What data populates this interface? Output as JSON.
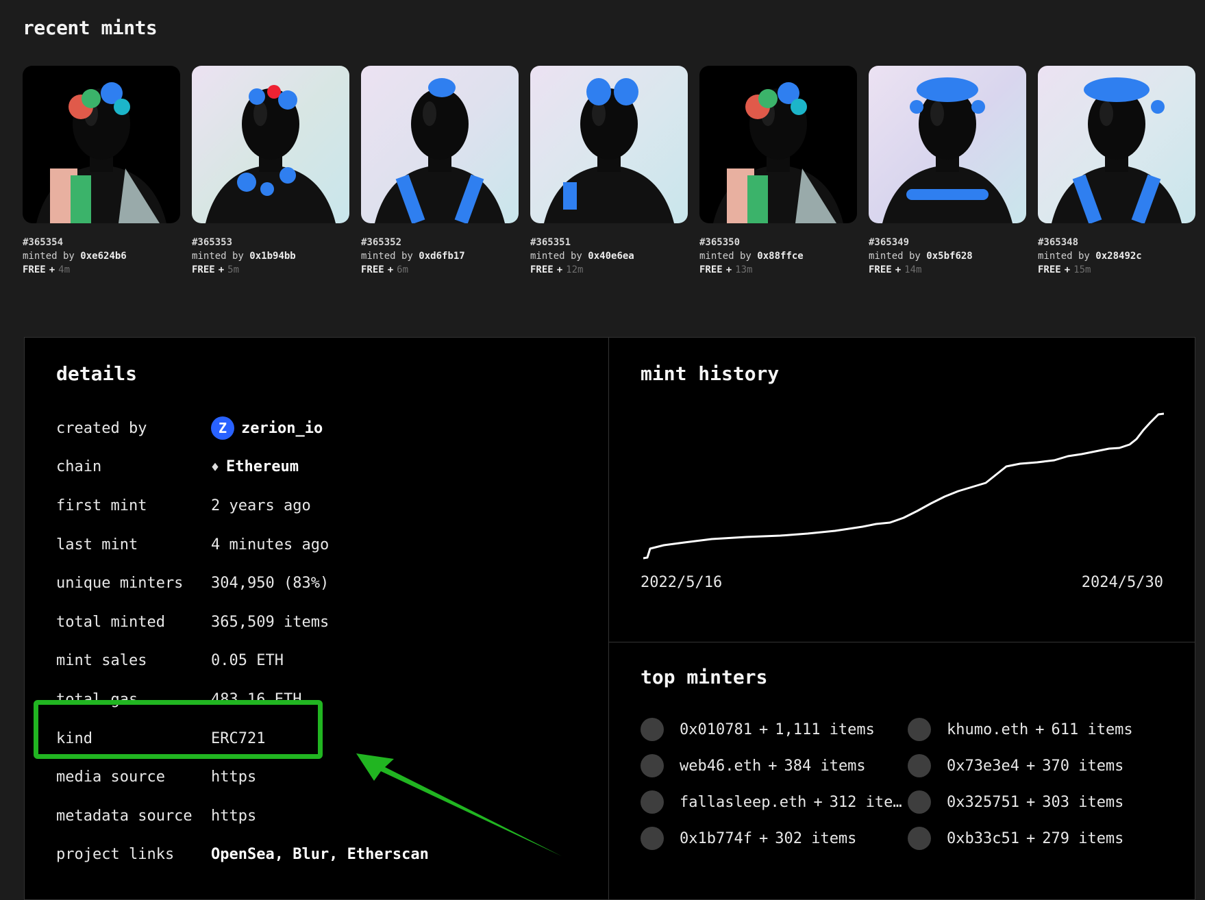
{
  "recent_title": "recent mints",
  "mints": [
    {
      "id": "#365354",
      "by_prefix": "minted by",
      "by": "0xe624b6",
      "price": "FREE",
      "sep": "+",
      "ago": "4m",
      "bg": "#000000",
      "accent": "#3aa0e0",
      "style": "colorful"
    },
    {
      "id": "#365353",
      "by_prefix": "minted by",
      "by": "0x1b94bb",
      "price": "FREE",
      "sep": "+",
      "ago": "5m",
      "bg": "#d8e6e4",
      "accent": "#2f7ff0",
      "style": "blobs"
    },
    {
      "id": "#365352",
      "by_prefix": "minted by",
      "by": "0xd6fb17",
      "price": "FREE",
      "sep": "+",
      "ago": "6m",
      "bg": "#dfe1ee",
      "accent": "#2f7ff0",
      "style": "straps"
    },
    {
      "id": "#365351",
      "by_prefix": "minted by",
      "by": "0x40e6ea",
      "price": "FREE",
      "sep": "+",
      "ago": "12m",
      "bg": "#dbe7ee",
      "accent": "#2f7ff0",
      "style": "bow"
    },
    {
      "id": "#365350",
      "by_prefix": "minted by",
      "by": "0x88ffce",
      "price": "FREE",
      "sep": "+",
      "ago": "13m",
      "bg": "#000000",
      "accent": "#3aa0e0",
      "style": "colorful"
    },
    {
      "id": "#365349",
      "by_prefix": "minted by",
      "by": "0x5bf628",
      "price": "FREE",
      "sep": "+",
      "ago": "14m",
      "bg": "#d9d6ee",
      "accent": "#2f7ff0",
      "style": "curls"
    },
    {
      "id": "#365348",
      "by_prefix": "minted by",
      "by": "0x28492c",
      "price": "FREE",
      "sep": "+",
      "ago": "15m",
      "bg": "#dde8ee",
      "accent": "#2f7ff0",
      "style": "curls-straps"
    }
  ],
  "details": {
    "title": "details",
    "created_by_label": "created by",
    "created_by_icon": "Z",
    "created_by": "zerion_io",
    "chain_label": "chain",
    "chain_icon": "♦",
    "chain": "Ethereum",
    "first_mint_label": "first mint",
    "first_mint": "2 years ago",
    "last_mint_label": "last mint",
    "last_mint": "4 minutes ago",
    "unique_minters_label": "unique minters",
    "unique_minters": "304,950 (83%)",
    "total_minted_label": "total minted",
    "total_minted": "365,509 items",
    "mint_sales_label": "mint sales",
    "mint_sales": "0.05 ETH",
    "total_gas_label": "total gas",
    "total_gas": "483.16 ETH",
    "kind_label": "kind",
    "kind": "ERC721",
    "media_source_label": "media source",
    "media_source": "https",
    "metadata_source_label": "metadata source",
    "metadata_source": "https",
    "project_links_label": "project links",
    "project_links": "OpenSea, Blur, Etherscan"
  },
  "history": {
    "title": "mint history",
    "start_date": "2022/5/16",
    "end_date": "2024/5/30"
  },
  "minters": {
    "title": "top minters",
    "sep": "+",
    "items": [
      {
        "name": "0x010781",
        "count": "1,111 items"
      },
      {
        "name": "khumo.eth",
        "count": "611 items"
      },
      {
        "name": "web46.eth",
        "count": "384 items"
      },
      {
        "name": "0x73e3e4",
        "count": "370 items"
      },
      {
        "name": "fallasleep.eth",
        "count": "312 ite…"
      },
      {
        "name": "0x325751",
        "count": "303 items"
      },
      {
        "name": "0x1b774f",
        "count": "302 items"
      },
      {
        "name": "0xb33c51",
        "count": "279 items"
      }
    ]
  },
  "colors": {
    "highlight": "#21b521",
    "zerion": "#2962ff"
  }
}
